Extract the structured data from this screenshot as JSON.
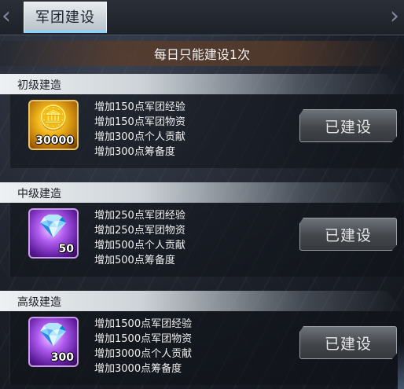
{
  "nav": {
    "left_arrow": "‹",
    "right_arrow": "›",
    "tab_label": "军团建设"
  },
  "notice": "每日只能建设1次",
  "colors": {
    "tab_active_underline": "#8ad2ff",
    "notice_bg": "#5c3c28",
    "button_bg": "#45494e"
  },
  "tiers": [
    {
      "title": "初级建造",
      "icon": "gold-coins-icon",
      "icon_glyph": "🪙",
      "quantity": "30000",
      "rewards": [
        "增加150点军团经验",
        "增加150点军团物资",
        "增加300点个人贡献",
        "增加300点筹备度"
      ],
      "button": "已建设"
    },
    {
      "title": "中级建造",
      "icon": "purple-gems-icon",
      "icon_glyph": "💎",
      "quantity": "50",
      "rewards": [
        "增加250点军团经验",
        "增加250点军团物资",
        "增加500点个人贡献",
        "增加500点筹备度"
      ],
      "button": "已建设"
    },
    {
      "title": "高级建造",
      "icon": "purple-gems-icon",
      "icon_glyph": "💎",
      "quantity": "300",
      "rewards": [
        "增加1500点军团经验",
        "增加1500点军团物资",
        "增加3000点个人贡献",
        "增加3000点筹备度"
      ],
      "button": "已建设"
    }
  ]
}
